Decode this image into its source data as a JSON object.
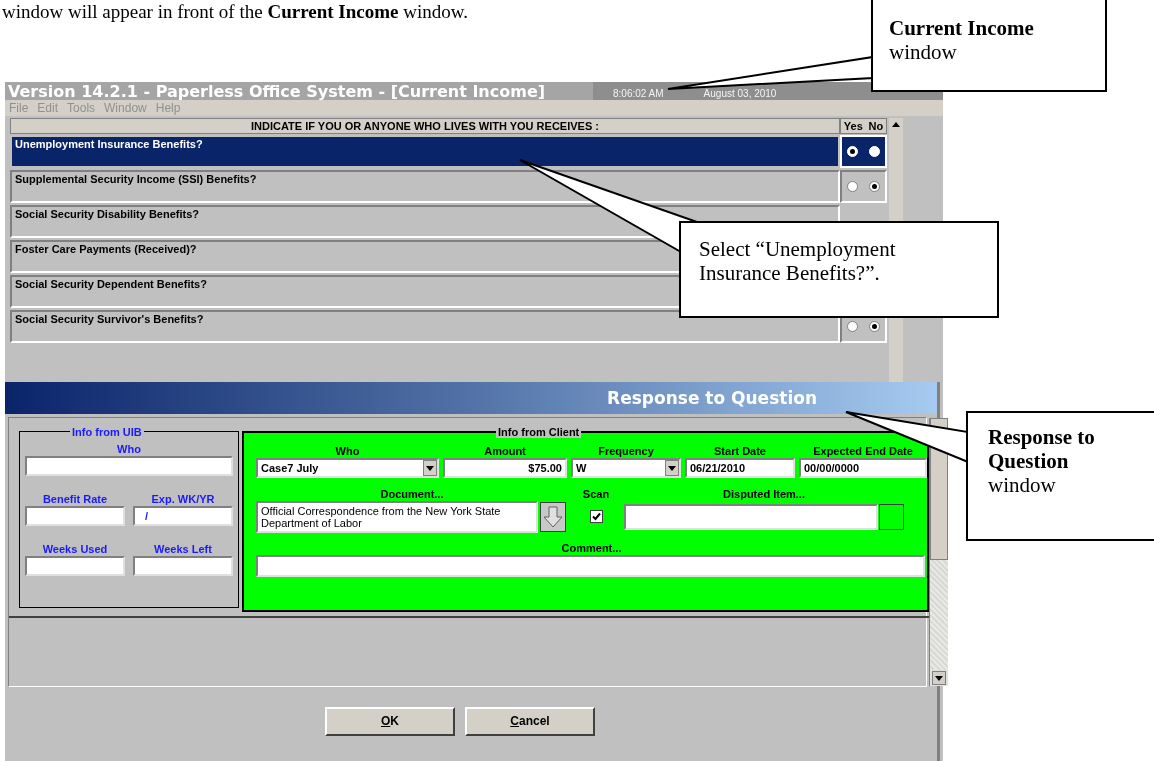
{
  "document_text": "window will appear in front of the **Current Income** window.",
  "window": {
    "title": "Version 14.2.1 - Paperless Office System - [Current Income]",
    "time": "8:06:02 AM",
    "date": "August 03, 2010"
  },
  "menu": [
    "File",
    "Edit",
    "Tools",
    "Window",
    "Help"
  ],
  "questions": {
    "header": "INDICATE IF YOU OR ANYONE WHO LIVES WITH YOU RECEIVES :",
    "yes_label": "Yes",
    "no_label": "No",
    "rows": [
      {
        "label": "Unemployment Insurance Benefits?",
        "selected": true,
        "radios": [
          {
            "selected": true
          },
          {
            "selected": false
          }
        ]
      },
      {
        "label": "Supplemental Security Income (SSI) Benefits?",
        "selected": false,
        "radios": [
          {
            "selected": false
          },
          {
            "selected": true
          }
        ]
      },
      {
        "label": "Social Security Disability Benefits?",
        "selected": false
      },
      {
        "label": "Foster Care Payments (Received)?",
        "selected": false
      },
      {
        "label": "Social Security Dependent Benefits?",
        "selected": false
      },
      {
        "label": "Social Security Survivor's Benefits?",
        "selected": false,
        "radios": [
          {
            "selected": false
          },
          {
            "selected": true
          }
        ]
      }
    ]
  },
  "dialog": {
    "title": "Response to Question",
    "uib": {
      "legend": "Info from UIB",
      "who_label": "Who",
      "benefit_rate_label": "Benefit Rate",
      "exp_label": "Exp. WK/YR",
      "exp_value": "/",
      "weeks_used_label": "Weeks Used",
      "weeks_left_label": "Weeks Left"
    },
    "client": {
      "legend": "Info from Client",
      "who_label": "Who",
      "who_value": "Case7 July",
      "amount_label": "Amount",
      "amount_value": "$75.00",
      "frequency_label": "Frequency",
      "frequency_value": "W",
      "start_label": "Start Date",
      "start_value": "06/21/2010",
      "end_label": "Expected End Date",
      "end_value": "00/00/0000",
      "document_label": "Document...",
      "document_value": "Official Correspondence from the New York State Department of Labor",
      "scan_label": "Scan",
      "scan_checked": true,
      "disputed_label": "Disputed Item...",
      "comment_label": "Comment..."
    },
    "buttons": [
      {
        "label": "OK"
      },
      {
        "label": "Cancel"
      }
    ]
  },
  "callouts": [
    {
      "text": "**Current Income**\nwindow"
    },
    {
      "text": "Select “Unemployment\nInsurance Benefits?”."
    },
    {
      "text": "**Response to**\n**Question**\nwindow"
    }
  ]
}
